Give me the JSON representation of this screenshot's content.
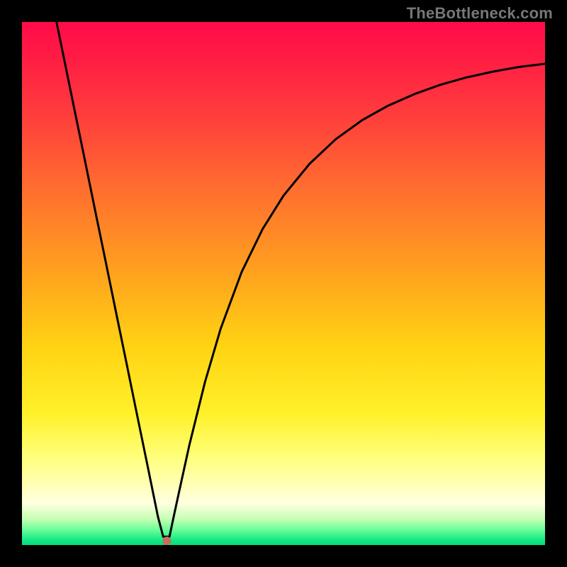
{
  "watermark": "TheBottleneck.com",
  "colors": {
    "frame": "#000000",
    "gradient_top": "#ff0b49",
    "gradient_mid": "#ffd313",
    "gradient_bottom": "#00dd7f",
    "curve": "#000000",
    "dot": "#cc6b5a"
  },
  "chart_data": {
    "type": "line",
    "title": "",
    "xlabel": "",
    "ylabel": "",
    "xlim": [
      0,
      100
    ],
    "ylim": [
      0,
      100
    ],
    "grid": false,
    "legend": false,
    "series": [
      {
        "name": "bottleneck-curve",
        "x": [
          6.6,
          8,
          10,
          12,
          14,
          16,
          18,
          20,
          22,
          24,
          26,
          27,
          27.5,
          28.2,
          29,
          30,
          32,
          35,
          38,
          42,
          46,
          50,
          55,
          60,
          65,
          70,
          75,
          80,
          85,
          90,
          95,
          100
        ],
        "y": [
          100,
          93.2,
          83.4,
          73.7,
          63.9,
          54.2,
          44.4,
          34.7,
          24.9,
          15.2,
          5.4,
          1.6,
          1.6,
          1.6,
          5.4,
          10,
          19.1,
          31.2,
          41.4,
          52.2,
          60.4,
          66.8,
          72.9,
          77.6,
          81.2,
          84,
          86.2,
          88,
          89.4,
          90.5,
          91.4,
          92
        ]
      }
    ],
    "markers": [
      {
        "name": "min-point-dot",
        "x": 27.7,
        "y": 0.8
      }
    ]
  }
}
